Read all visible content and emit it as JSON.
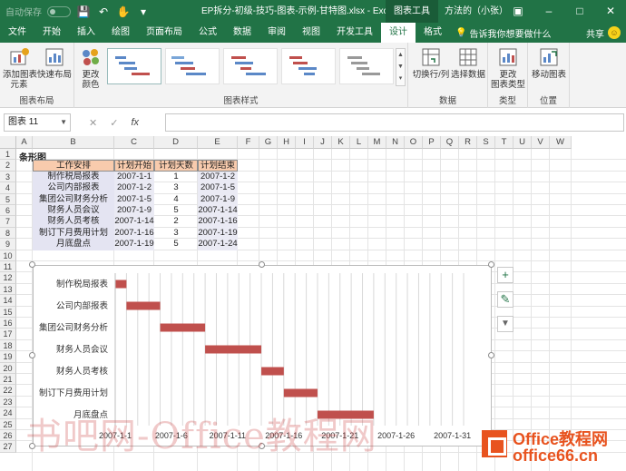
{
  "titlebar": {
    "autosave": "自动保存",
    "autosave_state": "关",
    "filename": "EP拆分-初级-技巧-图表-示例-甘特图.xlsx  -  Excel",
    "tools": "图表工具",
    "user": "方法的（小张）"
  },
  "tabs": [
    "文件",
    "开始",
    "插入",
    "绘图",
    "页面布局",
    "公式",
    "数据",
    "审阅",
    "视图",
    "开发工具",
    "设计",
    "格式"
  ],
  "active_tab": "设计",
  "tell_me": "告诉我你想要做什么",
  "share": "共享",
  "ribbon": {
    "add_element": "添加图表\n元素",
    "quick_layout": "快速布局",
    "group_layout": "图表布局",
    "change_colors": "更改\n颜色",
    "group_styles": "图表样式",
    "switch_row_col": "切换行/列",
    "select_data": "选择数据",
    "group_data": "数据",
    "change_type": "更改\n图表类型",
    "group_type": "类型",
    "move_chart": "移动图表",
    "group_location": "位置"
  },
  "namebox": "图表 11",
  "columns": [
    "A",
    "B",
    "C",
    "D",
    "E",
    "F",
    "G",
    "H",
    "I",
    "J",
    "K",
    "L",
    "M",
    "N",
    "O",
    "P",
    "Q",
    "R",
    "S",
    "T",
    "U",
    "V",
    "W"
  ],
  "rows": [
    "1",
    "2",
    "3",
    "4",
    "5",
    "6",
    "7",
    "8",
    "9",
    "10",
    "11",
    "12",
    "13",
    "14",
    "15",
    "16",
    "17",
    "18",
    "19",
    "20",
    "21",
    "22",
    "23",
    "24",
    "25",
    "26",
    "27"
  ],
  "sheet_title": "条形图",
  "table": {
    "headers": [
      "工作安排",
      "计划开始",
      "计划天数",
      "计划结束"
    ],
    "rows": [
      [
        "制作税局报表",
        "2007-1-1",
        "1",
        "2007-1-2"
      ],
      [
        "公司内部报表",
        "2007-1-2",
        "3",
        "2007-1-5"
      ],
      [
        "集团公司财务分析",
        "2007-1-5",
        "4",
        "2007-1-9"
      ],
      [
        "财务人员会议",
        "2007-1-9",
        "5",
        "2007-1-14"
      ],
      [
        "财务人员考核",
        "2007-1-14",
        "2",
        "2007-1-16"
      ],
      [
        "制订下月费用计划",
        "2007-1-16",
        "3",
        "2007-1-19"
      ],
      [
        "月底盘点",
        "2007-1-19",
        "5",
        "2007-1-24"
      ]
    ]
  },
  "chart_data": {
    "type": "bar",
    "orientation": "horizontal",
    "stacked_offset": true,
    "categories": [
      "制作税局报表",
      "公司内部报表",
      "集团公司财务分析",
      "财务人员会议",
      "财务人员考核",
      "制订下月费用计划",
      "月底盘点"
    ],
    "start": [
      "2007-1-1",
      "2007-1-2",
      "2007-1-5",
      "2007-1-9",
      "2007-1-14",
      "2007-1-16",
      "2007-1-19"
    ],
    "duration_days": [
      1,
      3,
      4,
      5,
      2,
      3,
      5
    ],
    "x_ticks": [
      "2007-1-1",
      "2007-1-6",
      "2007-1-11",
      "2007-1-16",
      "2007-1-21",
      "2007-1-26",
      "2007-1-31"
    ],
    "xlim": [
      "2007-1-1",
      "2007-2-1"
    ],
    "bar_color": "#c0504d",
    "grid": true
  },
  "chart_buttons": [
    "chart-elements",
    "chart-styles",
    "chart-filters"
  ],
  "watermark": "书吧网-Office教程网",
  "logo": {
    "line1": "Office教程网",
    "line2": "office66.cn"
  },
  "colors": {
    "excel_green": "#217346",
    "header_fill": "#f8cbad",
    "bar": "#c0504d"
  }
}
